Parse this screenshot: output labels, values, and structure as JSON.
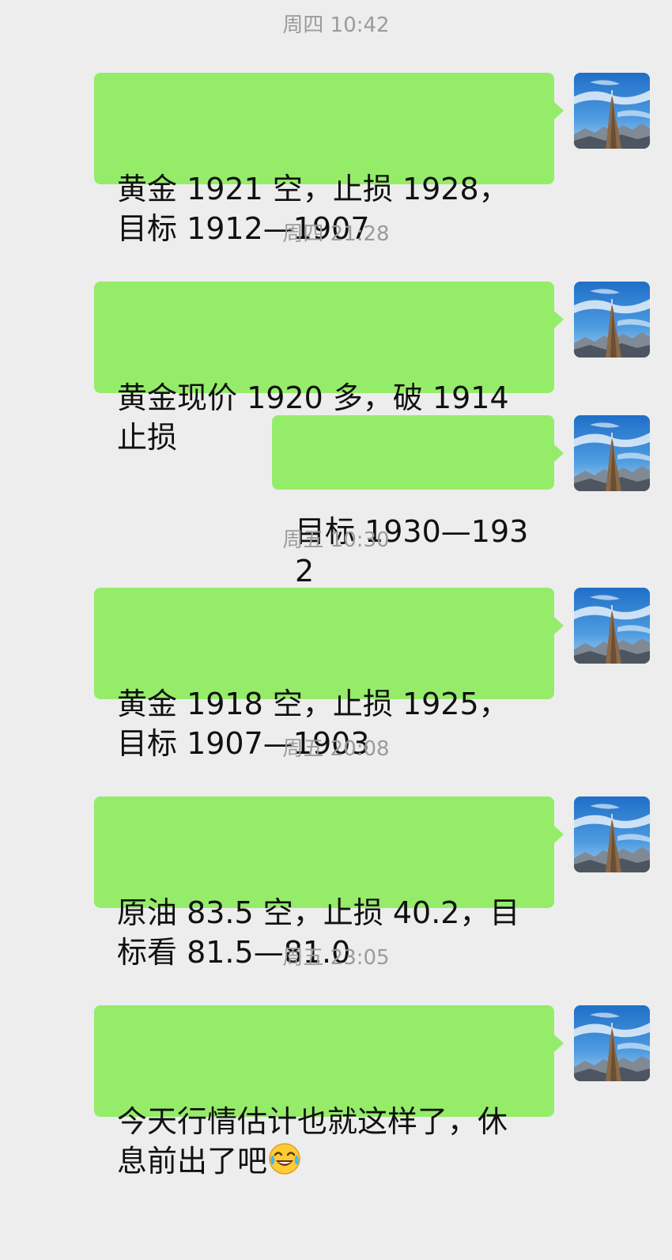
{
  "messages": [
    {
      "time": "周四 10:42",
      "text": "黄金 1921 空，止损 1928，目标 1912—1907"
    },
    {
      "time": "周四 21:28",
      "text": "黄金现价 1920 多，破 1914 止损"
    },
    {
      "time": "",
      "text": "目标 1930—1932"
    },
    {
      "time": "周五 10:30",
      "text": "黄金 1918 空，止损 1925，目标 1907—1903"
    },
    {
      "time": "周五 20:08",
      "text": "原油 83.5 空，止损 40.2，目标看 81.5—81.0"
    },
    {
      "time": "周五 23:05",
      "text": "今天行情估计也就这样了，休息前出了吧"
    }
  ],
  "last_emoji": "face-with-tears-of-joy-emoji",
  "colors": {
    "background": "#ededed",
    "bubble": "#95ec69",
    "timestamp": "#9b9b9b",
    "text": "#111111"
  }
}
